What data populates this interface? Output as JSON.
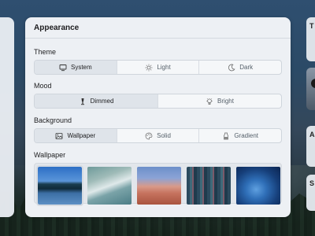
{
  "card": {
    "title": "Appearance"
  },
  "theme": {
    "label": "Theme",
    "options": [
      {
        "label": "System",
        "icon": "monitor-icon",
        "selected": true
      },
      {
        "label": "Light",
        "icon": "sun-icon",
        "selected": false
      },
      {
        "label": "Dark",
        "icon": "moon-icon",
        "selected": false
      }
    ]
  },
  "mood": {
    "label": "Mood",
    "options": [
      {
        "label": "Dimmed",
        "icon": "lamp-icon",
        "selected": true
      },
      {
        "label": "Bright",
        "icon": "bulb-icon",
        "selected": false
      }
    ]
  },
  "background": {
    "label": "Background",
    "options": [
      {
        "label": "Wallpaper",
        "icon": "image-icon",
        "selected": true
      },
      {
        "label": "Solid",
        "icon": "palette-icon",
        "selected": false
      },
      {
        "label": "Gradient",
        "icon": "gradient-icon",
        "selected": false
      }
    ]
  },
  "wallpaper": {
    "label": "Wallpaper",
    "items": [
      {
        "name": "lake-mountains",
        "selected": true
      },
      {
        "name": "ocean-waves",
        "selected": false
      },
      {
        "name": "desert-dunes",
        "selected": false
      },
      {
        "name": "city-aerial",
        "selected": false
      },
      {
        "name": "blue-abstract",
        "selected": false
      }
    ]
  },
  "side_panels": {
    "top_initial": "T",
    "mid_initial": "A",
    "bottom_initial": "S"
  }
}
